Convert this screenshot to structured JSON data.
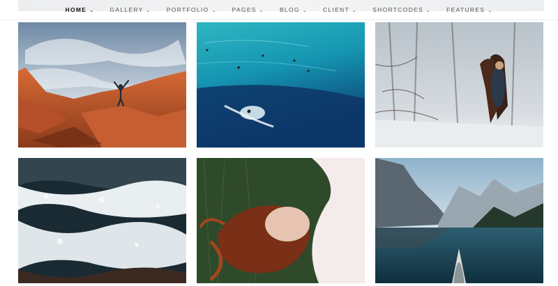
{
  "nav": {
    "items": [
      {
        "label": "HOME",
        "active": true
      },
      {
        "label": "GALLERY"
      },
      {
        "label": "PORTFOLIO"
      },
      {
        "label": "PAGES"
      },
      {
        "label": "BLOG"
      },
      {
        "label": "CLIENT"
      },
      {
        "label": "SHORTCODES"
      },
      {
        "label": "FEATURES"
      }
    ],
    "chevron": "chevron-down-icon"
  },
  "gallery": {
    "photos": [
      {
        "subject": "red-rock-canyon-hiker"
      },
      {
        "subject": "ocean-surfers-aerial"
      },
      {
        "subject": "girl-with-horse-winter-forest"
      },
      {
        "subject": "crashing-waves-rocks"
      },
      {
        "subject": "woman-lying-on-grass"
      },
      {
        "subject": "mountain-lake-canoe"
      }
    ]
  },
  "colors": {
    "nav_text": "#555555",
    "nav_active": "#111111",
    "divider": "#ececec"
  }
}
